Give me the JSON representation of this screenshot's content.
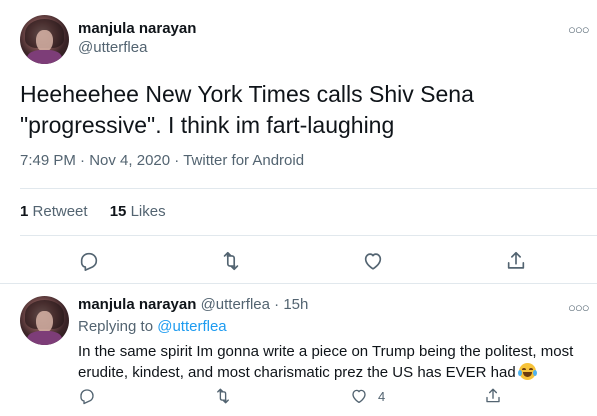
{
  "tweet": {
    "author_name": "manjula narayan",
    "author_handle": "@utterflea",
    "text": "Heeheehee New York Times calls Shiv Sena \"progressive\". I think im fart-laughing",
    "time": "7:49 PM",
    "date": "Nov 4, 2020",
    "source": "Twitter for Android",
    "retweets_count": "1",
    "retweets_label": "Retweet",
    "likes_count": "15",
    "likes_label": "Likes",
    "more_icon": "more-icon"
  },
  "reply": {
    "author_name": "manjula narayan",
    "author_handle": "@utterflea",
    "age": "15h",
    "replying_to_label": "Replying to",
    "replying_to_handle": "@utterflea",
    "text": "In the same spirit Im gonna write a piece on Trump being the politest, most erudite, kindest, and most charismatic prez the US has EVER had",
    "emoji": "face-with-tears-of-joy",
    "likes_count": "4"
  },
  "colors": {
    "text_primary": "#0f1419",
    "text_secondary": "#536471",
    "link": "#1d9bf0",
    "divider": "#e1e8ed"
  }
}
